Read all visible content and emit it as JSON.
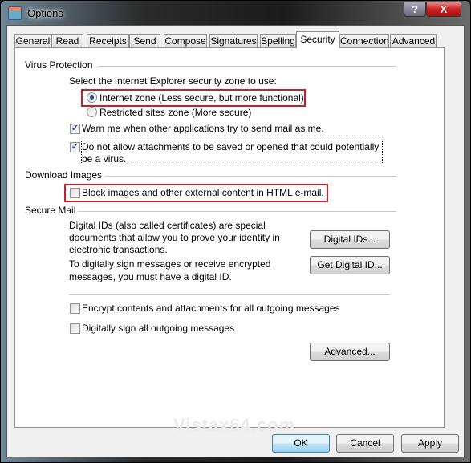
{
  "window": {
    "title": "Options",
    "help": "?",
    "close": "X"
  },
  "tabs": [
    {
      "label": "General"
    },
    {
      "label": "Read"
    },
    {
      "label": "Receipts"
    },
    {
      "label": "Send"
    },
    {
      "label": "Compose"
    },
    {
      "label": "Signatures"
    },
    {
      "label": "Spelling"
    },
    {
      "label": "Security",
      "selected": true
    },
    {
      "label": "Connection"
    },
    {
      "label": "Advanced"
    }
  ],
  "virus": {
    "heading": "Virus Protection",
    "zone_prompt": "Select the Internet Explorer security zone to use:",
    "zones": [
      {
        "label": "Internet zone (Less secure, but more functional)",
        "selected": true
      },
      {
        "label": "Restricted sites zone (More secure)",
        "selected": false
      }
    ],
    "warn": {
      "label": "Warn me when other applications try to send mail as me.",
      "checked": true
    },
    "attach": {
      "line1": "Do not allow attachments to be saved or opened that could potentially",
      "line2": "be a virus.",
      "checked": true
    }
  },
  "images": {
    "heading": "Download Images",
    "block": {
      "label": "Block images and other external content in HTML e-mail.",
      "checked": false
    }
  },
  "secure": {
    "heading": "Secure Mail",
    "ids_text": [
      "Digital IDs (also called certificates) are special",
      "documents that allow you to prove your identity in",
      "electronic transactions."
    ],
    "sign_text": [
      "To digitally sign messages or receive encrypted",
      "messages, you must have a digital ID."
    ],
    "digital_ids_button": "Digital IDs...",
    "get_id_button": "Get Digital ID...",
    "encrypt": {
      "label": "Encrypt contents and attachments for all outgoing messages",
      "checked": false
    },
    "sign": {
      "label": "Digitally sign all outgoing messages",
      "checked": false
    },
    "advanced_button": "Advanced..."
  },
  "watermark": "Vistax64.com",
  "footer": {
    "ok": "OK",
    "cancel": "Cancel",
    "apply": "Apply"
  },
  "colors": {
    "highlight": "#c8202a",
    "default_button": "#c4e5f6"
  }
}
